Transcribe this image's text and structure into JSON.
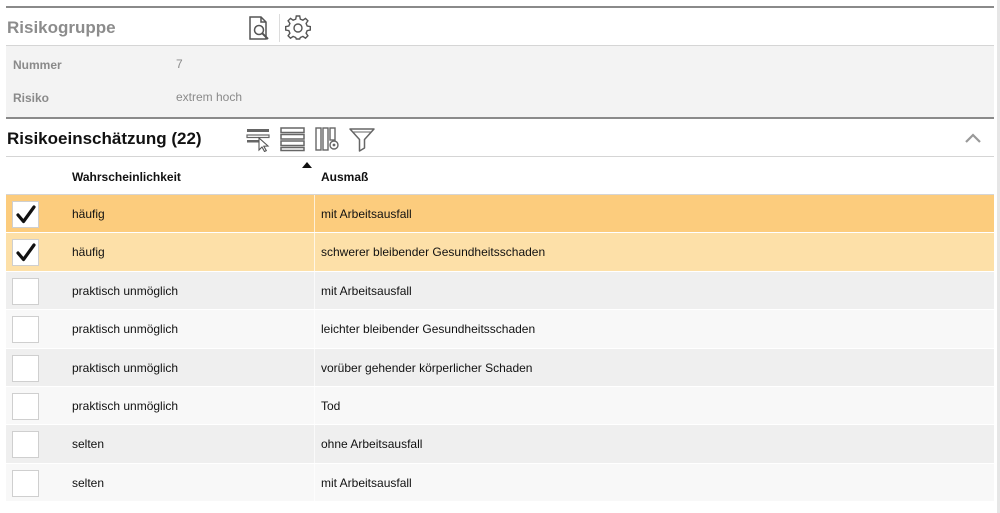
{
  "group": {
    "title": "Risikogruppe",
    "fields": [
      {
        "label": "Nummer",
        "value": "7"
      },
      {
        "label": "Risiko",
        "value": "extrem hoch"
      }
    ]
  },
  "assessment": {
    "title": "Risikoeinschätzung (22)",
    "columns": [
      "Wahrscheinlichkeit",
      "Ausmaß"
    ],
    "rows": [
      {
        "checked": true,
        "probability": "häufig",
        "extent": "mit Arbeitsausfall"
      },
      {
        "checked": true,
        "probability": "häufig",
        "extent": "schwerer bleibender Gesundheitsschaden"
      },
      {
        "checked": false,
        "probability": "praktisch unmöglich",
        "extent": "mit Arbeitsausfall"
      },
      {
        "checked": false,
        "probability": "praktisch unmöglich",
        "extent": "leichter bleibender Gesundheitsschaden"
      },
      {
        "checked": false,
        "probability": "praktisch unmöglich",
        "extent": "vorüber gehender körperlicher Schaden"
      },
      {
        "checked": false,
        "probability": "praktisch unmöglich",
        "extent": "Tod"
      },
      {
        "checked": false,
        "probability": "selten",
        "extent": "ohne Arbeitsausfall"
      },
      {
        "checked": false,
        "probability": "selten",
        "extent": "mit Arbeitsausfall"
      }
    ]
  },
  "icons": {
    "group_header": [
      "document-search-icon",
      "gear-icon"
    ],
    "toolbar": [
      "select-rows-icon",
      "list-view-icon",
      "column-settings-icon",
      "filter-icon"
    ],
    "collapse": "chevron-up-icon",
    "sort": "sort-ascending-icon"
  },
  "colors": {
    "selected_row_primary": "#fccc7d",
    "selected_row_secondary": "#fde0a8",
    "row_alt": "#efefef",
    "row_plain": "#f8f8f8"
  }
}
